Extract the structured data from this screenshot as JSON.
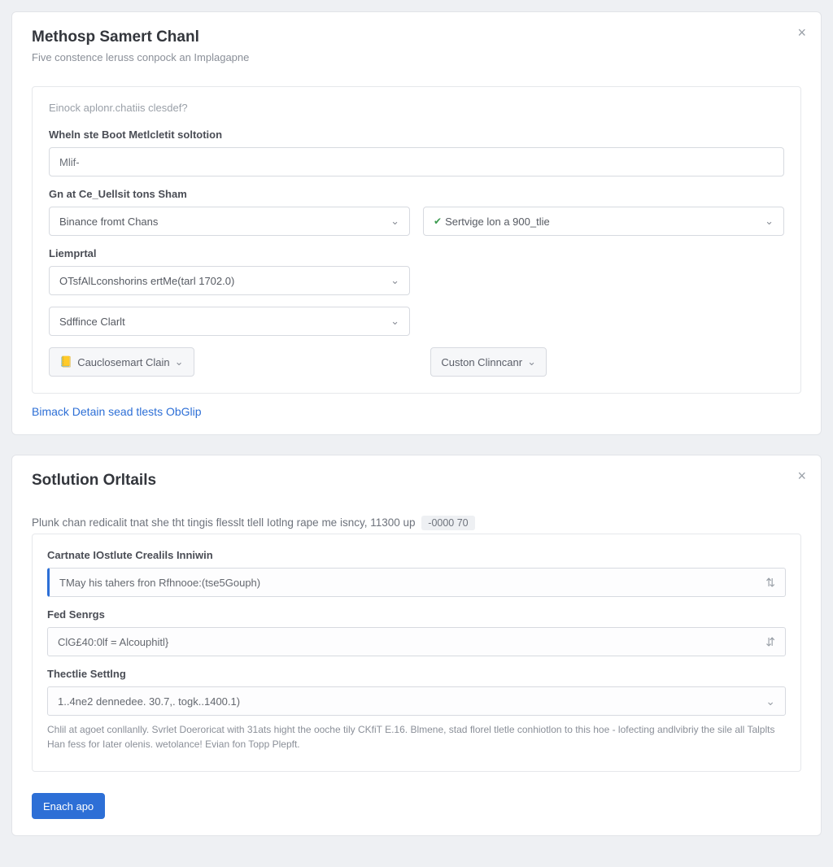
{
  "panel1": {
    "title": "Methosp Samert Chanl",
    "subtitle": "Five constence leruss conpock an Implagapne",
    "close": "×",
    "box_hint": "Einock aplonr.chatiis clesdef?",
    "label_when": "Wheln ste Boot Metlcletit soltotion",
    "input_when": "Mlif-",
    "label_chain": "Gn at Ce_Uellsit tons Sham",
    "select_chain": "Binance fromt Chans",
    "select_serv": "Sertvige lon a 900_tlie",
    "label_lemp": "Liemprtal",
    "select_lemp": "OTsfAlLconshorins ertMe(tarl 1702.0)",
    "select_soft": "Sdffince Clarlt",
    "btn_cauc": "Cauclosemart Clain",
    "btn_cauc_icon": "📒",
    "btn_cust": "Custon Clinncanr",
    "link_bin": "Bimack Detain sead tlests ObGlip"
  },
  "panel2": {
    "title": "Sotlution Orltails",
    "close": "×",
    "lead_text": "Plunk chan redicalit tnat she tht tingis flesslt tlell Iotlng rape me isncy, 11300 up",
    "lead_badge": "-0000 70",
    "label_cart": "Cartnate IOstlute Crealils Inniwin",
    "field_cart": "TMay his tahers fron Rfhnooe:(tse5Gouph)",
    "label_fed": "Fed Senrgs",
    "field_fed": "ClG£40:0lf = Alcouphitl}",
    "label_thec": "Thectlie Settlng",
    "field_thec": "1..4ne2 dennedee. 30.7,. togk..1400.1)",
    "hint": "Chlil at agoet conllanlly. Svrlet Doeroricat with 31ats hight the ooche tily CKfiT E.16. Blmene, stad florel tletle conhiotlon to this hoe - lofecting andlvibriy the sile all Talplts Han fess for Iater olenis. wetolance! Evian fon Topp Plepft.",
    "primary": "Enach apo"
  }
}
